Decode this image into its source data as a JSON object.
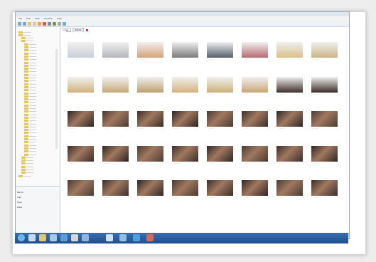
{
  "menu": [
    "File",
    "Edit",
    "View",
    "Window",
    "Help"
  ],
  "tabs": [
    "Local",
    "Panel"
  ],
  "breadcrumb": "Files",
  "properties": [
    "Name",
    "Size",
    "Type",
    "Date"
  ],
  "status": "",
  "colors": {
    "taskbar": "#2a5d9f",
    "folder": "#e7c35a",
    "selection": "#3a86d6"
  },
  "thumbnails": [
    {
      "color": "#c9cfd8",
      "cap": "..........."
    },
    {
      "color": "#b4b7bb",
      "cap": "..........."
    },
    {
      "color": "#d8a27a",
      "cap": "..........."
    },
    {
      "color": "#7a7a7a",
      "cap": "..........."
    },
    {
      "color": "#555e6a",
      "cap": "..........."
    },
    {
      "color": "#b66a70",
      "cap": "..........."
    },
    {
      "color": "#d9c089",
      "cap": "..........."
    },
    {
      "color": "#cbb486",
      "cap": "..........."
    },
    {
      "color": "#d2b27b",
      "cap": "..........."
    },
    {
      "color": "#c6a777",
      "cap": "..........."
    },
    {
      "color": "#bfa06e",
      "cap": "..........."
    },
    {
      "color": "#d4b27e",
      "cap": "..........."
    },
    {
      "color": "#cbb07a",
      "cap": "..........."
    },
    {
      "color": "#c9a675",
      "cap": "..........."
    },
    {
      "color": "#3c2f2a",
      "cap": "..........."
    },
    {
      "color": "#3a2c26",
      "cap": "..........."
    },
    {
      "color": "#2d2522",
      "cap": "..........."
    },
    {
      "color": "#4a3a30",
      "cap": "..........."
    },
    {
      "color": "#3a2d27",
      "cap": "..........."
    },
    {
      "color": "#2e2421",
      "cap": "..........."
    },
    {
      "color": "#4a3a31",
      "cap": "..........."
    },
    {
      "color": "#3b2e29",
      "cap": "..........."
    },
    {
      "color": "#2f2623",
      "cap": "..........."
    },
    {
      "color": "#4b3b33",
      "cap": "..........."
    },
    {
      "color": "#3a2e28",
      "cap": "..........."
    },
    {
      "color": "#2c2320",
      "cap": "..........."
    },
    {
      "color": "#4c3c32",
      "cap": "..........."
    },
    {
      "color": "#3b2f29",
      "cap": "..........."
    },
    {
      "color": "#2e2522",
      "cap": "..........."
    },
    {
      "color": "#4a3a30",
      "cap": "..........."
    },
    {
      "color": "#3b2e29",
      "cap": "..........."
    },
    {
      "color": "#2f2622",
      "cap": "..........."
    },
    {
      "color": "#4b3c32",
      "cap": "..........."
    },
    {
      "color": "#3c2f29",
      "cap": "..........."
    },
    {
      "color": "#2e2421",
      "cap": "..........."
    },
    {
      "color": "#4a3a31",
      "cap": "..........."
    },
    {
      "color": "#3a2e28",
      "cap": "..........."
    },
    {
      "color": "#2f2522",
      "cap": "..........."
    },
    {
      "color": "#4b3b32",
      "cap": "..........."
    },
    {
      "color": "#3b2e29",
      "cap": "..........."
    }
  ]
}
